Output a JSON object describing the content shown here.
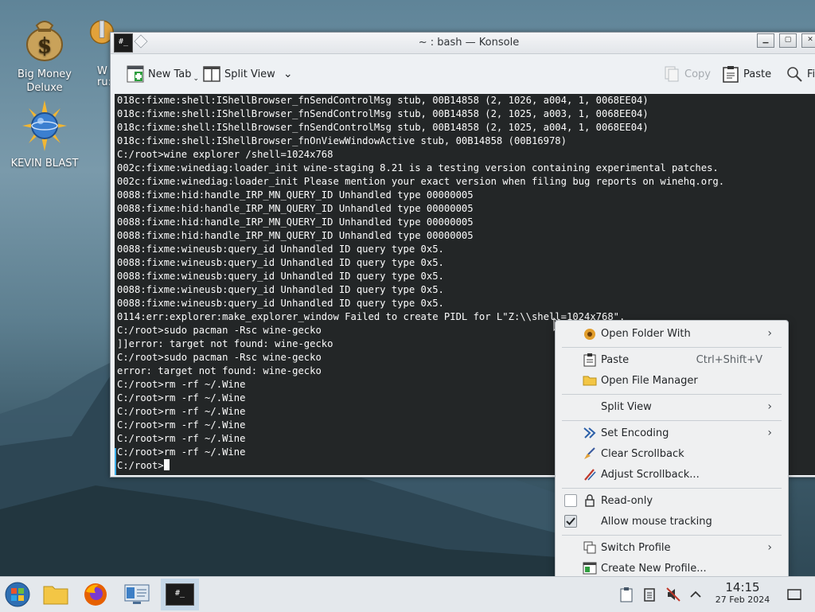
{
  "desktop": {
    "icons": [
      {
        "label_line1": "Big Money",
        "label_line2": "Deluxe"
      },
      {
        "label": "KEVIN BLAST"
      },
      {
        "label_partial": "ru:"
      },
      {
        "label_partial2": "W"
      }
    ]
  },
  "window": {
    "title": "~ : bash — Konsole",
    "app_icon_text": "#_"
  },
  "toolbar": {
    "new_tab": "New Tab",
    "split_view": "Split View",
    "copy": "Copy",
    "paste": "Paste",
    "find": "Fi"
  },
  "terminal": {
    "lines": [
      "018c:fixme:shell:IShellBrowser_fnSendControlMsg stub, 00B14858 (2, 1026, a004, 1, 0068EE04)",
      "018c:fixme:shell:IShellBrowser_fnSendControlMsg stub, 00B14858 (2, 1025, a003, 1, 0068EE04)",
      "018c:fixme:shell:IShellBrowser_fnSendControlMsg stub, 00B14858 (2, 1025, a004, 1, 0068EE04)",
      "018c:fixme:shell:IShellBrowser_fnOnViewWindowActive stub, 00B14858 (00B16978)",
      "C:/root>wine explorer /shell=1024x768",
      "002c:fixme:winediag:loader_init wine-staging 8.21 is a testing version containing experimental patches.",
      "002c:fixme:winediag:loader_init Please mention your exact version when filing bug reports on winehq.org.",
      "0088:fixme:hid:handle_IRP_MN_QUERY_ID Unhandled type 00000005",
      "0088:fixme:hid:handle_IRP_MN_QUERY_ID Unhandled type 00000005",
      "0088:fixme:hid:handle_IRP_MN_QUERY_ID Unhandled type 00000005",
      "0088:fixme:hid:handle_IRP_MN_QUERY_ID Unhandled type 00000005",
      "0088:fixme:wineusb:query_id Unhandled ID query type 0x5.",
      "0088:fixme:wineusb:query_id Unhandled ID query type 0x5.",
      "0088:fixme:wineusb:query_id Unhandled ID query type 0x5.",
      "0088:fixme:wineusb:query_id Unhandled ID query type 0x5.",
      "0088:fixme:wineusb:query_id Unhandled ID query type 0x5.",
      "0114:err:explorer:make_explorer_window Failed to create PIDL for L\"Z:\\\\shell=1024x768\".",
      "C:/root>sudo pacman -Rsc wine-gecko",
      "]]error: target not found: wine-gecko",
      "C:/root>sudo pacman -Rsc wine-gecko",
      "error: target not found: wine-gecko",
      "C:/root>rm -rf ~/.Wine",
      "C:/root>rm -rf ~/.Wine",
      "C:/root>rm -rf ~/.Wine",
      "C:/root>rm -rf ~/.Wine",
      "C:/root>rm -rf ~/.Wine",
      "C:/root>rm -rf ~/.Wine"
    ],
    "prompt": "C:/root>"
  },
  "context_menu": {
    "open_folder_with": "Open Folder With",
    "paste": "Paste",
    "paste_shortcut": "Ctrl+Shift+V",
    "open_file_manager": "Open File Manager",
    "split_view": "Split View",
    "set_encoding": "Set Encoding",
    "clear_scrollback": "Clear Scrollback",
    "adjust_scrollback": "Adjust Scrollback...",
    "read_only": "Read-only",
    "read_only_checked": false,
    "allow_mouse_tracking": "Allow mouse tracking",
    "allow_mouse_tracking_checked": true,
    "switch_profile": "Switch Profile",
    "create_new_profile": "Create New Profile..."
  },
  "taskbar": {
    "clock_time": "14:15",
    "clock_date": "27 Feb 2024",
    "active_task_label": "#_"
  },
  "colors": {
    "terminal_bg": "#232627",
    "terminal_fg": "#fcfcfc",
    "accent": "#3daee9"
  }
}
